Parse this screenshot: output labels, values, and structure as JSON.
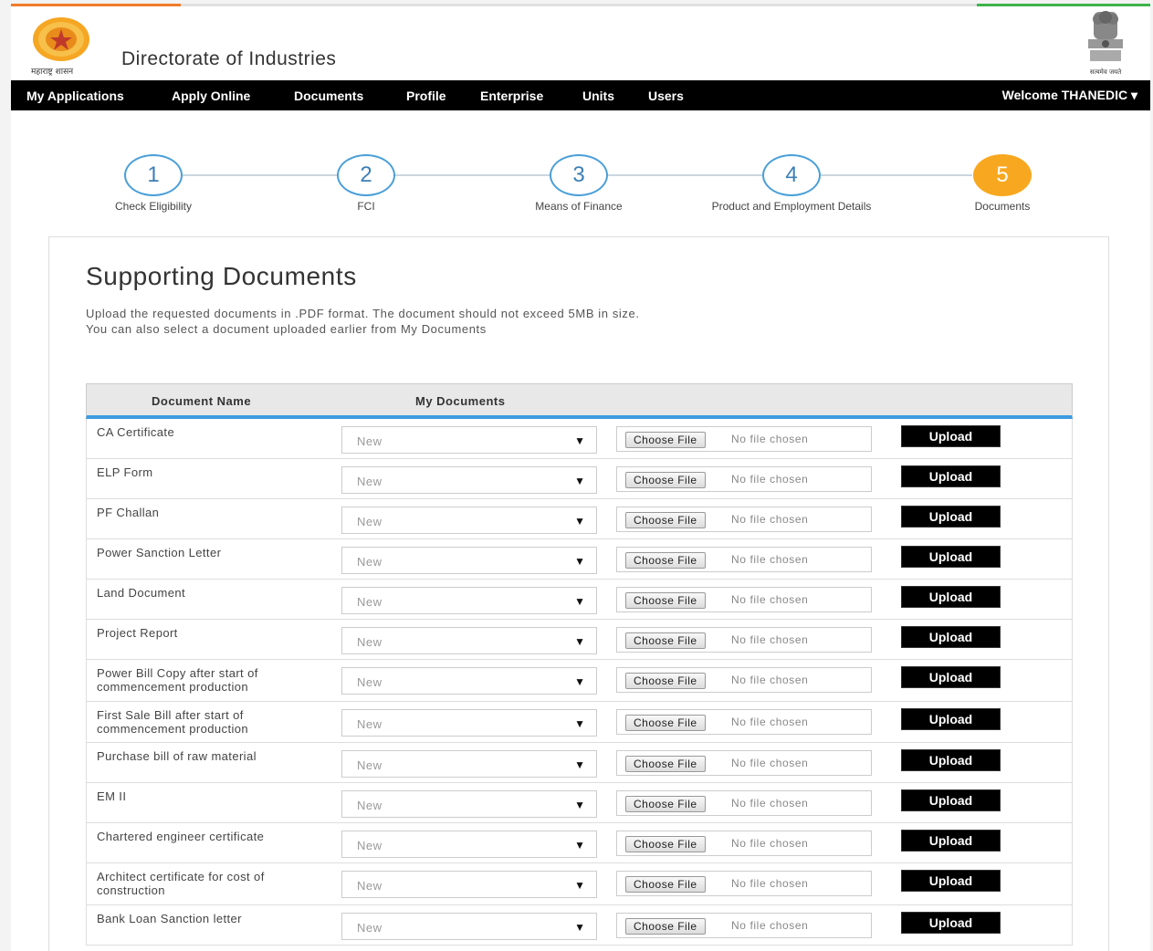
{
  "header": {
    "logo_caption": "महाराष्ट्र शासन",
    "title": "Directorate of Industries",
    "emblem_caption": "सत्यमेव जयते"
  },
  "nav": {
    "items": [
      "My Applications",
      "Apply Online",
      "Documents",
      "Profile",
      "Enterprise",
      "Units",
      "Users"
    ],
    "user": "Welcome THANEDIC"
  },
  "steps": [
    {
      "num": "1",
      "label": "Check Eligibility"
    },
    {
      "num": "2",
      "label": "FCI"
    },
    {
      "num": "3",
      "label": "Means of Finance"
    },
    {
      "num": "4",
      "label": "Product and Employment Details"
    },
    {
      "num": "5",
      "label": "Documents"
    }
  ],
  "active_step": "5",
  "section": {
    "title": "Supporting Documents",
    "desc_line1": "Upload the requested documents in .PDF format. The document should not exceed 5MB in size.",
    "desc_line2": "You can also select a document uploaded earlier from My Documents"
  },
  "table": {
    "headers": [
      "Document Name",
      "My Documents"
    ],
    "select_value": "New",
    "choose_label": "Choose File",
    "no_file": "No file chosen",
    "upload_label": "Upload",
    "rows": [
      {
        "name": "CA Certificate"
      },
      {
        "name": "ELP Form"
      },
      {
        "name": "PF Challan"
      },
      {
        "name": "Power Sanction Letter"
      },
      {
        "name": "Land Document"
      },
      {
        "name": "Project Report"
      },
      {
        "name": "Power Bill Copy after start of commencement production"
      },
      {
        "name": "First Sale Bill after start of commencement production"
      },
      {
        "name": "Purchase bill of raw material"
      },
      {
        "name": "EM II"
      },
      {
        "name": "Chartered engineer certificate"
      },
      {
        "name": "Architect certificate for cost of construction"
      },
      {
        "name": "Bank Loan Sanction letter"
      }
    ]
  },
  "colors": {
    "accent_blue": "#3d9be0",
    "active_step": "#f8a820",
    "navbar": "#000000"
  }
}
